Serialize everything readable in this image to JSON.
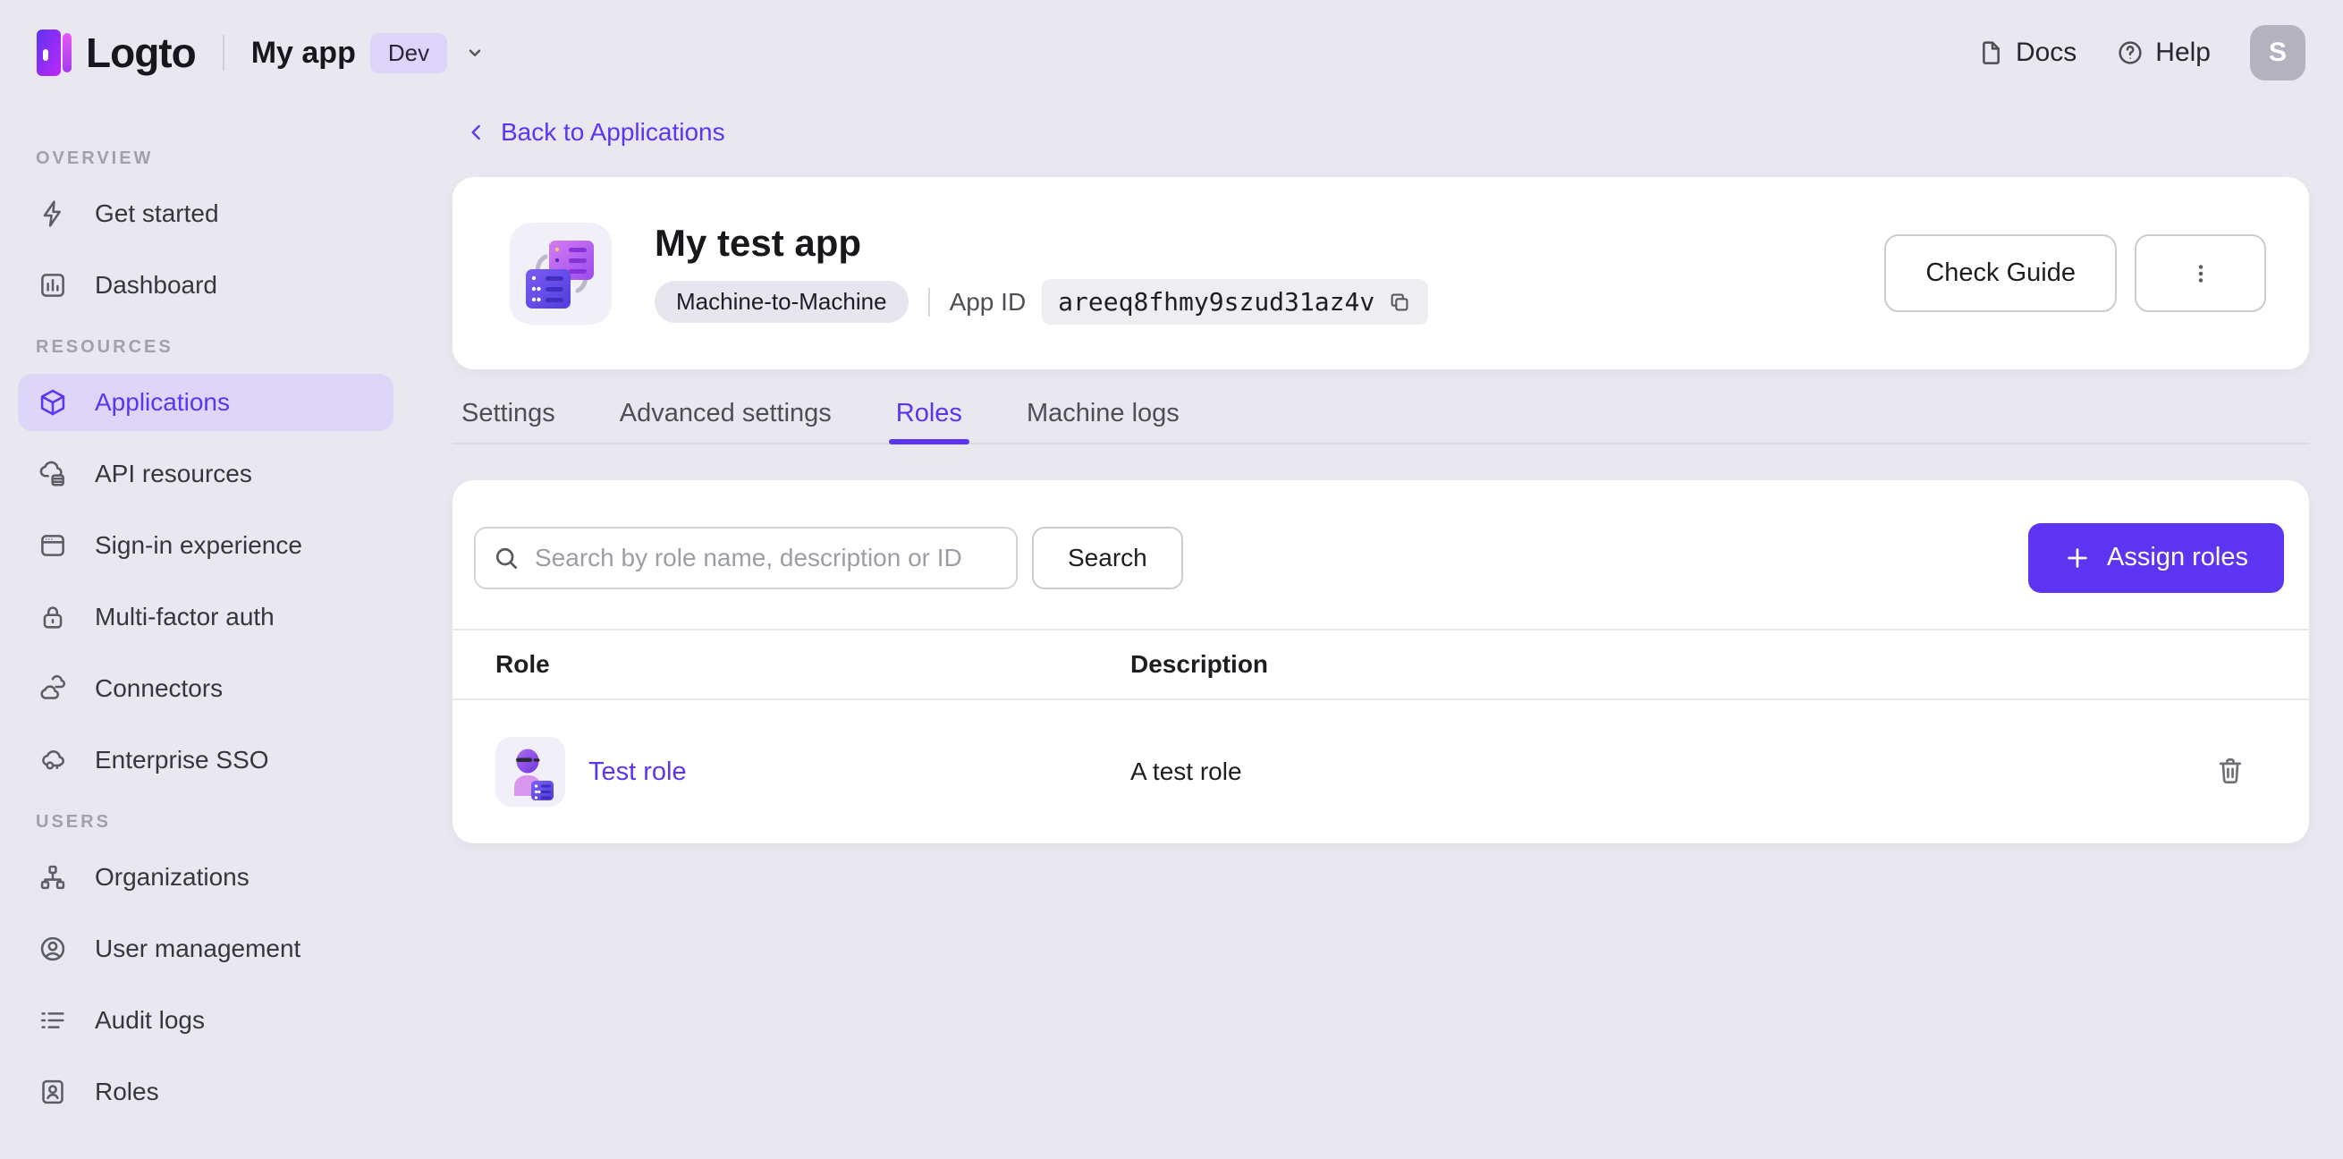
{
  "header": {
    "brand": "Logto",
    "tenant_name": "My app",
    "env_badge": "Dev",
    "docs": "Docs",
    "help": "Help",
    "avatar_initial": "S"
  },
  "sidebar": {
    "sections": [
      {
        "label": "OVERVIEW",
        "items": [
          {
            "label": "Get started"
          },
          {
            "label": "Dashboard"
          }
        ]
      },
      {
        "label": "RESOURCES",
        "items": [
          {
            "label": "Applications",
            "active": true
          },
          {
            "label": "API resources"
          },
          {
            "label": "Sign-in experience"
          },
          {
            "label": "Multi-factor auth"
          },
          {
            "label": "Connectors"
          },
          {
            "label": "Enterprise SSO"
          }
        ]
      },
      {
        "label": "USERS",
        "items": [
          {
            "label": "Organizations"
          },
          {
            "label": "User management"
          },
          {
            "label": "Audit logs"
          },
          {
            "label": "Roles"
          }
        ]
      }
    ]
  },
  "main": {
    "back_link": "Back to Applications",
    "app_header": {
      "title": "My test app",
      "type_badge": "Machine-to-Machine",
      "app_id_label": "App ID",
      "app_id_value": "areeq8fhmy9szud31az4v",
      "check_guide_label": "Check Guide"
    },
    "tabs": [
      {
        "label": "Settings",
        "active": false
      },
      {
        "label": "Advanced settings",
        "active": false
      },
      {
        "label": "Roles",
        "active": true
      },
      {
        "label": "Machine logs",
        "active": false
      }
    ],
    "roles_panel": {
      "search_placeholder": "Search by role name, description or ID",
      "search_button_label": "Search",
      "assign_button_label": "Assign roles",
      "columns": {
        "role": "Role",
        "description": "Description"
      },
      "rows": [
        {
          "role_name": "Test role",
          "description": "A test role"
        }
      ]
    }
  },
  "colors": {
    "accent": "#5d34f2",
    "page_bg": "#e9e8f1",
    "card_bg": "#ffffff",
    "sidebar_active_bg": "#ddd6f8",
    "env_badge_bg": "#ded3f9"
  }
}
